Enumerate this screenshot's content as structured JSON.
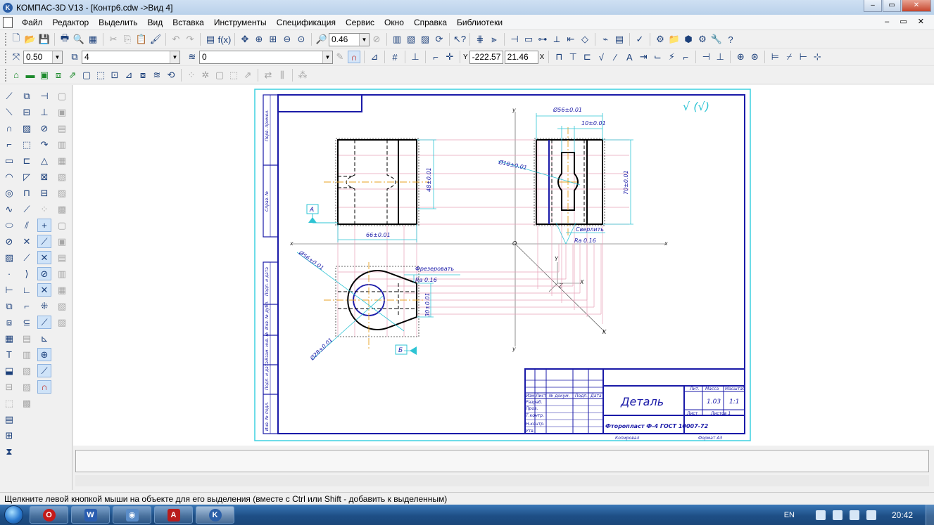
{
  "window": {
    "title": "КОМПАС-3D V13 - [Контр6.cdw ->Вид 4]",
    "buttons": [
      "–",
      "▭",
      "✕"
    ]
  },
  "menu": [
    "Файл",
    "Редактор",
    "Выделить",
    "Вид",
    "Вставка",
    "Инструменты",
    "Спецификация",
    "Сервис",
    "Окно",
    "Справка",
    "Библиотеки"
  ],
  "toolbar1": {
    "zoom_value": "0.46"
  },
  "toolbar2": {
    "step_value": "0.50",
    "view_value": "4",
    "layer_value": "0",
    "coord_x": "-222.57",
    "coord_y": "21.46",
    "x_label": "Y",
    "y_label": "X"
  },
  "drawing": {
    "roughness_mark": "√ (√)",
    "dim_56_top": "Ø56±0.01",
    "dim_10": "10±0.01",
    "dim_18": "Ø18±0.01",
    "dim_70": "70±0.01",
    "dim_48": "48±0.01",
    "dim_66": "66±0.01",
    "dim_56_left": "Ø56±0.01",
    "dim_28": "Ø28±0.01",
    "dim_30": "30±0.01",
    "note_drill": "Сверлить",
    "ra_right": "Ra 0.16",
    "note_mill": "Фрезеровать",
    "ra_left": "Ra 0.16",
    "section_a": "А",
    "section_b": "Б",
    "axis_x_left": "x",
    "axis_x_right": "x",
    "axis_y_top": "y",
    "axis_y_bottom": "y",
    "axis_o": "O",
    "axis_k": "K",
    "axis_y_small": "Y",
    "axis_x_small": "X",
    "axis_z_small": "Z",
    "part_name": "Деталь",
    "material": "Фторопласт Ф-4 ГОСТ 10007-72",
    "copied": "Копировал",
    "format": "Формат   А3",
    "col_lit": "Лит.",
    "col_mass": "Масса",
    "col_scale": "Масштаб",
    "mass_value": "1.03",
    "scale_value": "1:1",
    "sheet": "Лист",
    "sheets": "Листов  1",
    "row_labels": [
      "Изм",
      "Лист",
      "№ докум.",
      "Подп.",
      "Дата"
    ],
    "sign_rows": [
      "Разраб.",
      "Пров.",
      "Т.контр.",
      "",
      "Н.контр.",
      "Утв."
    ],
    "side_labels": [
      "Перв. примен.",
      "Справ. №",
      "Подп. и дата",
      "Инв. № дубл.",
      "Взам. инв. №",
      "Подп. и дата",
      "Инв. № подл."
    ]
  },
  "status_text": "Щелкните левой кнопкой мыши на объекте для его выделения (вместе с Ctrl или Shift - добавить к выделенным)",
  "tray": {
    "lang": "EN",
    "time": "20:42"
  }
}
